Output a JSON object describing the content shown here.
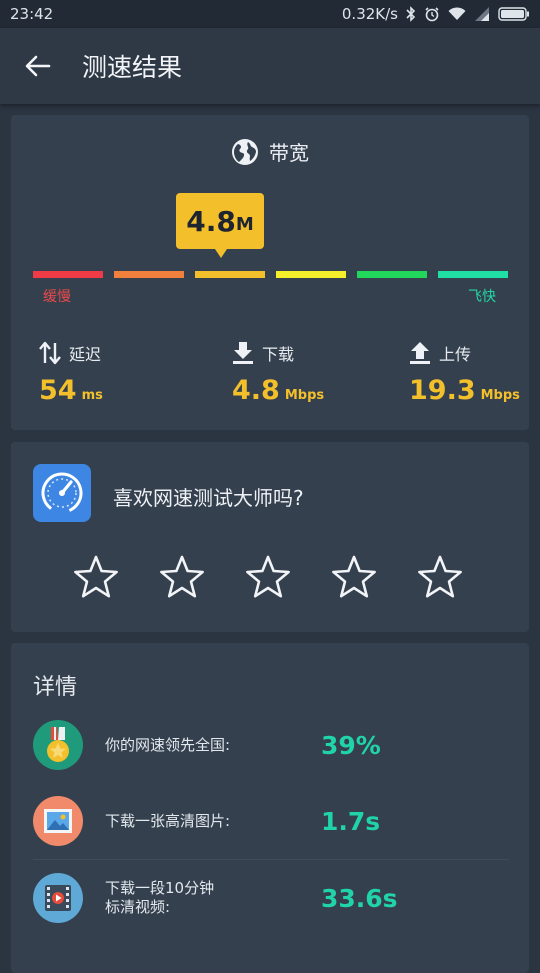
{
  "status_bar": {
    "time": "23:42",
    "net_speed": "0.32K/s"
  },
  "header": {
    "title": "测速结果"
  },
  "bandwidth": {
    "title": "带宽",
    "bubble_value": "4.8",
    "bubble_unit": "M",
    "scale_low": "缓慢",
    "scale_high": "飞快",
    "scale_colors": [
      "#ef3b45",
      "#f0803c",
      "#f3c02b",
      "#f5ee2b",
      "#22d85c",
      "#1fdfa4"
    ],
    "metrics": {
      "latency": {
        "label": "延迟",
        "value": "54",
        "unit": "ms"
      },
      "download": {
        "label": "下载",
        "value": "4.8",
        "unit": "Mbps"
      },
      "upload": {
        "label": "上传",
        "value": "19.3",
        "unit": "Mbps"
      }
    }
  },
  "rating": {
    "question": "喜欢网速测试大师吗?",
    "star_count": 5,
    "stars_selected": 0
  },
  "details": {
    "title": "详情",
    "rows": [
      {
        "label": "你的网速领先全国:",
        "value": "39%"
      },
      {
        "label": "下载一张高清图片:",
        "value": "1.7s"
      },
      {
        "label_line1": "下载一段10分钟",
        "label_line2": "标清视频:",
        "value": "33.6s"
      }
    ]
  },
  "colors": {
    "accent_yellow": "#f3c02b",
    "accent_teal": "#20d3a8",
    "background": "#2b3441",
    "card": "#34404e"
  }
}
